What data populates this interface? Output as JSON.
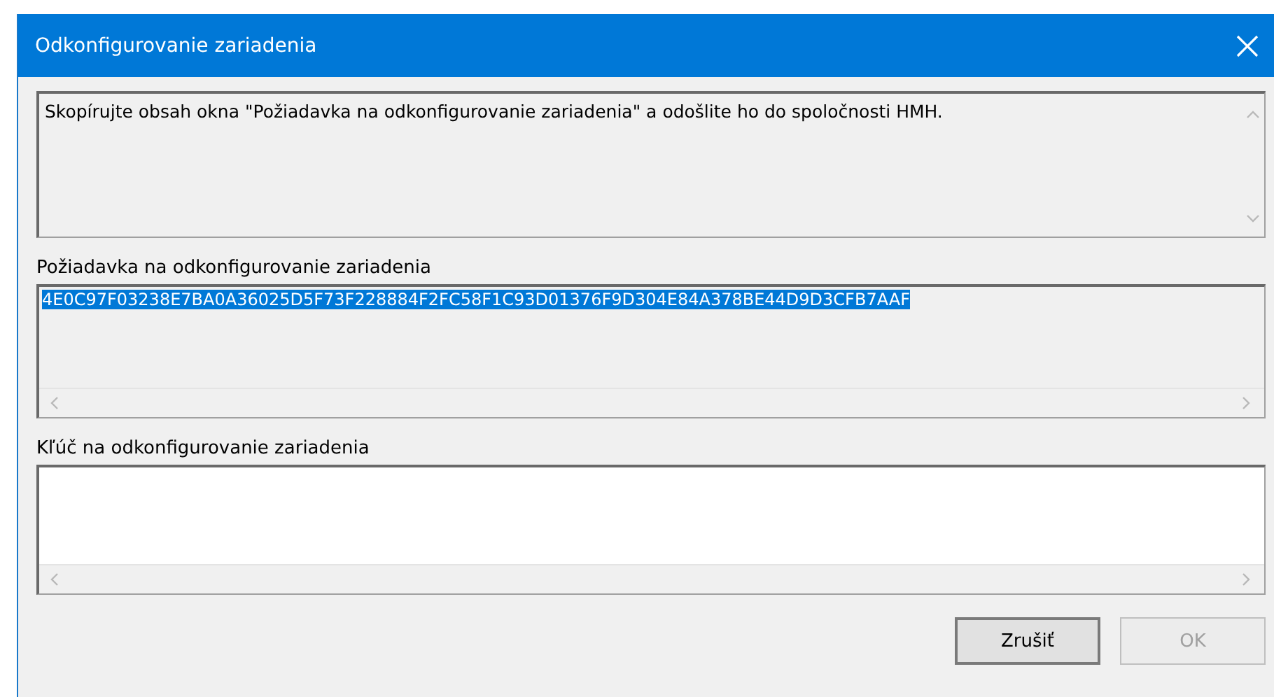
{
  "window": {
    "title": "Odkonfigurovanie zariadenia"
  },
  "message": {
    "text": "Skopírujte obsah okna \"Požiadavka na odkonfigurovanie zariadenia\" a odošlite ho do spoločnosti HMH."
  },
  "request": {
    "label": "Požiadavka na odkonfigurovanie zariadenia",
    "value": "4E0C97F03238E7BA0A36025D5F73F228884F2FC58F1C93D01376F9D304E84A378BE44D9D3CFB7AAF",
    "selected": true
  },
  "key": {
    "label": "Kľúč na odkonfigurovanie zariadenia"
  },
  "buttons": [
    {
      "label": "Zrušiť",
      "disabled": false
    },
    {
      "label": "OK",
      "disabled": true
    }
  ]
}
